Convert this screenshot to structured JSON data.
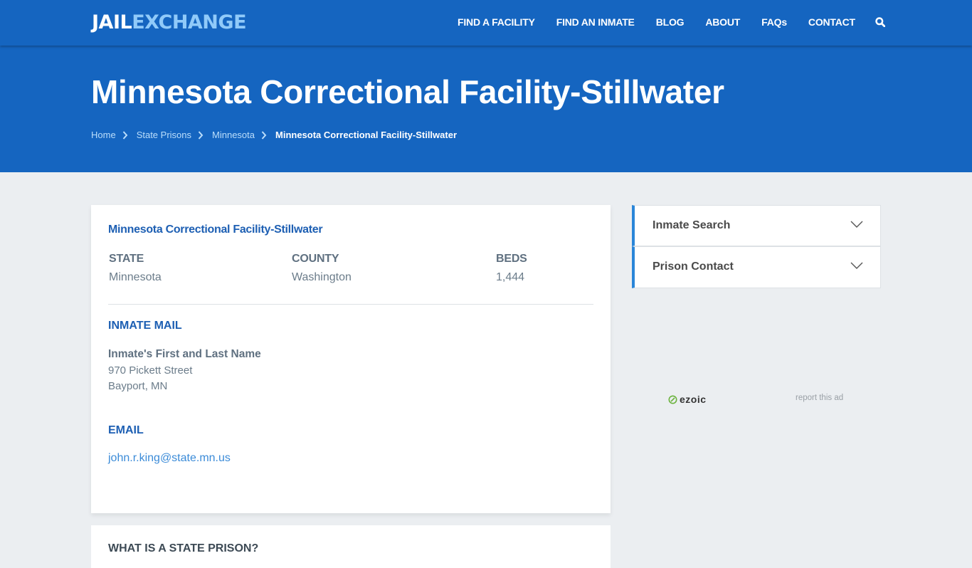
{
  "site": {
    "logo_part1": "JAIL",
    "logo_part2": "EXCHANGE"
  },
  "nav": {
    "items": [
      "FIND A FACILITY",
      "FIND AN INMATE",
      "BLOG",
      "ABOUT",
      "FAQs",
      "CONTACT"
    ],
    "search_icon": "search-icon"
  },
  "hero": {
    "title": "Minnesota Correctional Facility-Stillwater",
    "breadcrumb": [
      "Home",
      "State Prisons",
      "Minnesota",
      "Minnesota Correctional Facility-Stillwater"
    ]
  },
  "facility": {
    "title": "Minnesota Correctional Facility-Stillwater",
    "state_label": "STATE",
    "state_value": "Minnesota",
    "county_label": "COUNTY",
    "county_value": "Washington",
    "beds_label": "BEDS",
    "beds_value": "1,444",
    "mail_heading": "INMATE MAIL",
    "mail_name": "Inmate's First and Last Name",
    "mail_street": "970 Pickett Street",
    "mail_city": "Bayport, MN",
    "email_heading": "EMAIL",
    "email": "john.r.king@state.mn.us"
  },
  "next_section": {
    "heading": "WHAT IS A STATE PRISON?"
  },
  "sidebar": {
    "accordions": [
      "Inmate Search",
      "Prison Contact"
    ],
    "ad_brand": "ezoic",
    "ad_report": "report this ad"
  },
  "colors": {
    "brand_blue": "#1565c0",
    "logo_accent": "#90caf9",
    "heading_blue": "#1d5fb3",
    "link_blue": "#3b8bd8",
    "accordion_accent": "#2a86d8"
  }
}
